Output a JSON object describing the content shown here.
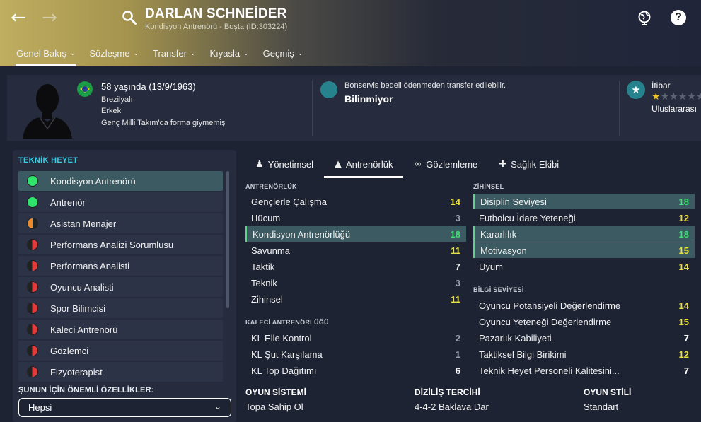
{
  "header": {
    "name": "DARLAN SCHNEİDER",
    "subtitle": "Kondisyon Antrenörü - Boşta (ID:303224)"
  },
  "tabs": [
    {
      "label": "Genel Bakış"
    },
    {
      "label": "Sözleşme"
    },
    {
      "label": "Transfer"
    },
    {
      "label": "Kıyasla"
    },
    {
      "label": "Geçmiş"
    }
  ],
  "info": {
    "age": "58 yaşında (13/9/1963)",
    "nationality": "Brezilyalı",
    "gender": "Erkek",
    "youth": "Genç Milli Takım'da forma giymemiş",
    "transfer_note": "Bonservis bedeli ödenmeden transfer edilebilir.",
    "transfer_value": "Bilinmiyor",
    "reputation_title": "İtibar",
    "reputation_level": "Uluslararası",
    "reputation_stars": 1
  },
  "staff": {
    "title": "TEKNİK HEYET",
    "items": [
      {
        "label": "Kondisyon Antrenörü",
        "status": "green"
      },
      {
        "label": "Antrenör",
        "status": "green"
      },
      {
        "label": "Asistan Menajer",
        "status": "half"
      },
      {
        "label": "Performans Analizi Sorumlusu",
        "status": "red"
      },
      {
        "label": "Performans Analisti",
        "status": "red"
      },
      {
        "label": "Oyuncu Analisti",
        "status": "red"
      },
      {
        "label": "Spor Bilimcisi",
        "status": "red"
      },
      {
        "label": "Kaleci Antrenörü",
        "status": "red"
      },
      {
        "label": "Gözlemci",
        "status": "red"
      },
      {
        "label": "Fizyoterapist",
        "status": "red"
      }
    ],
    "attributes_label": "ŞUNUN İÇİN ÖNEMLİ ÖZELLİKLER:",
    "select_value": "Hepsi"
  },
  "sub_tabs": [
    {
      "label": "Yönetimsel"
    },
    {
      "label": "Antrenörlük"
    },
    {
      "label": "Gözlemleme"
    },
    {
      "label": "Sağlık Ekibi"
    }
  ],
  "coaching": {
    "title": "ANTRENÖRLÜK",
    "rows": [
      {
        "label": "Gençlerle Çalışma",
        "value": "14"
      },
      {
        "label": "Hücum",
        "value": "3"
      },
      {
        "label": "Kondisyon Antrenörlüğü",
        "value": "18"
      },
      {
        "label": "Savunma",
        "value": "11"
      },
      {
        "label": "Taktik",
        "value": "7"
      },
      {
        "label": "Teknik",
        "value": "3"
      },
      {
        "label": "Zihinsel",
        "value": "11"
      }
    ]
  },
  "gk": {
    "title": "KALECİ ANTRENÖRLÜĞÜ",
    "rows": [
      {
        "label": "KL Elle Kontrol",
        "value": "2"
      },
      {
        "label": "KL Şut Karşılama",
        "value": "1"
      },
      {
        "label": "KL Top Dağıtımı",
        "value": "6"
      }
    ]
  },
  "mental": {
    "title": "ZİHİNSEL",
    "rows": [
      {
        "label": "Disiplin Seviyesi",
        "value": "18"
      },
      {
        "label": "Futbolcu İdare Yeteneği",
        "value": "12"
      },
      {
        "label": "Kararlılık",
        "value": "18"
      },
      {
        "label": "Motivasyon",
        "value": "15"
      },
      {
        "label": "Uyum",
        "value": "14"
      }
    ]
  },
  "knowledge": {
    "title": "BİLGİ SEVİYESİ",
    "rows": [
      {
        "label": "Oyuncu Potansiyeli Değerlendirme",
        "value": "14"
      },
      {
        "label": "Oyuncu Yeteneği Değerlendirme",
        "value": "15"
      },
      {
        "label": "Pazarlık Kabiliyeti",
        "value": "7"
      },
      {
        "label": "Taktiksel Bilgi Birikimi",
        "value": "12"
      },
      {
        "label": "Teknik Heyet Personeli Kalitesini...",
        "value": "7"
      }
    ]
  },
  "bottom": {
    "system_label": "OYUN SİSTEMİ",
    "system_value": "Topa Sahip Ol",
    "formation_label": "DİZİLİŞ TERCİHİ",
    "formation_value": "4-4-2 Baklava Dar",
    "style_label": "OYUN STİLİ",
    "style_value": "Standart"
  },
  "colors": {
    "accent_cyan": "#34d0e8",
    "highlight_row": "#3b5a62",
    "value_yellow": "#e9df3c",
    "value_green": "#41e072"
  }
}
